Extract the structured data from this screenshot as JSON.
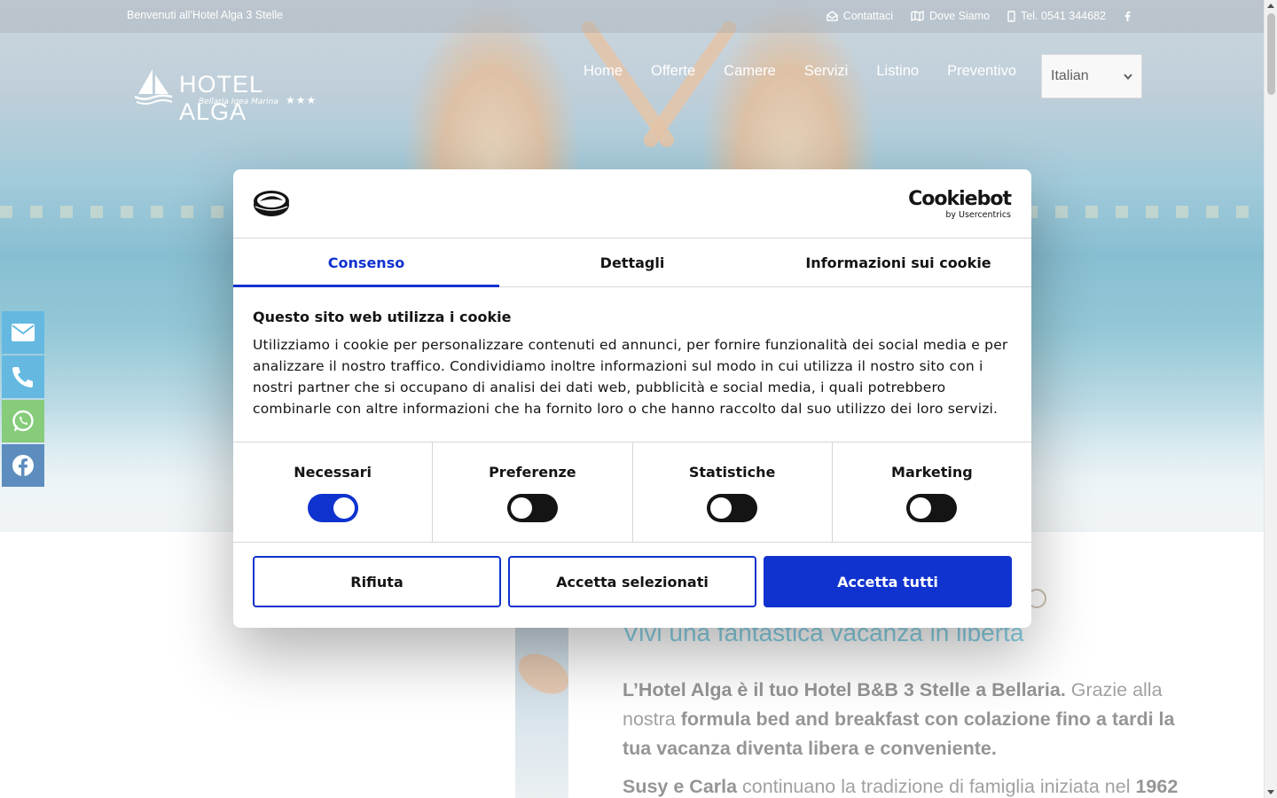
{
  "topbar": {
    "welcome": "Benvenuti all'Hotel Alga 3 Stelle",
    "contact": "Contattaci",
    "where": "Dove Siamo",
    "phone": "Tel. 0541 344682"
  },
  "logo": {
    "name": "HOTEL ALGA",
    "subtitle": "Bellaria Igea Marina",
    "stars": "★★★"
  },
  "nav": {
    "items": [
      "Home",
      "Offerte",
      "Camere",
      "Servizi",
      "Listino",
      "Preventivo"
    ]
  },
  "language": {
    "selected": "Italian"
  },
  "content": {
    "tagline": "Vivi una fantastica vacanza in libertà",
    "p1_bold1": "L’Hotel Alga è il tuo Hotel B&B 3 Stelle a Bellaria.",
    "p1_text1": " Grazie alla nostra ",
    "p1_bold2": "formula bed and breakfast con colazione fino a tardi la tua vacanza diventa libera e conveniente.",
    "p2_bold1": "Susy e Carla",
    "p2_text1": " continuano la tradizione di famiglia iniziata nel ",
    "p2_bold2": "1962"
  },
  "cookie": {
    "brand": "Cookiebot",
    "brand_sub": "by Usercentrics",
    "tabs": [
      "Consenso",
      "Dettagli",
      "Informazioni sui cookie"
    ],
    "heading": "Questo sito web utilizza i cookie",
    "text": "Utilizziamo i cookie per personalizzare contenuti ed annunci, per fornire funzionalità dei social media e per analizzare il nostro traffico. Condividiamo inoltre informazioni sul modo in cui utilizza il nostro sito con i nostri partner che si occupano di analisi dei dati web, pubblicità e social media, i quali potrebbero combinarle con altre informazioni che ha fornito loro o che hanno raccolto dal suo utilizzo dei loro servizi.",
    "categories": [
      {
        "label": "Necessari",
        "on": true
      },
      {
        "label": "Preferenze",
        "on": false
      },
      {
        "label": "Statistiche",
        "on": false
      },
      {
        "label": "Marketing",
        "on": false
      }
    ],
    "buttons": {
      "reject": "Rifiuta",
      "accept_selected": "Accetta selezionati",
      "accept_all": "Accetta tutti"
    }
  },
  "colors": {
    "cookie_accent": "#1032cf",
    "mail": "#2a9fd6",
    "whatsapp": "#58b947",
    "facebook": "#1f62a6",
    "tagline": "#5bbfdc"
  },
  "icons": {
    "topbar": [
      "envelope-open-icon",
      "map-icon",
      "mobile-phone-icon",
      "facebook-icon"
    ],
    "side": [
      "envelope-icon",
      "phone-icon",
      "whatsapp-icon",
      "facebook-icon"
    ]
  }
}
